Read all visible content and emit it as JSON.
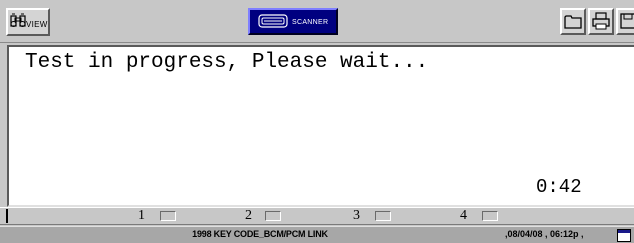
{
  "toolbar": {
    "view_label": "VIEW",
    "scanner_label": "SCANNER",
    "icons": [
      "binoculars-icon",
      "scanner-icon",
      "folder-icon",
      "printer-icon",
      "save-icon"
    ]
  },
  "screen": {
    "message": "Test in progress, Please wait...",
    "timer": "0:42"
  },
  "function_keys": [
    {
      "number": "1"
    },
    {
      "number": "2"
    },
    {
      "number": "3"
    },
    {
      "number": "4"
    }
  ],
  "status_bar": {
    "title": "1998 KEY CODE_BCM/PCM LINK",
    "datetime": ",08/04/08 , 06:12p ,"
  },
  "colors": {
    "scanner_button": "#000080",
    "screen_background": "#ffffff",
    "status_bar": "#a7a7a7"
  }
}
